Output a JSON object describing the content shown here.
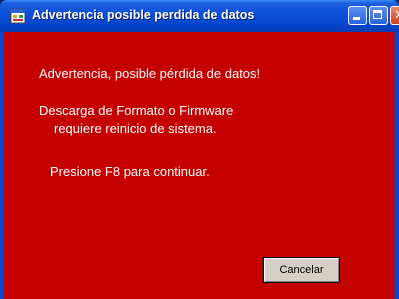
{
  "window": {
    "title": "Advertencia posible perdida de datos"
  },
  "message": {
    "line1": "Advertencia, posible pérdida de datos!",
    "line2": "Descarga de  Formato o Firmware",
    "line3": "requiere   reinicio de sistema.",
    "line4": "Presione F8 para continuar."
  },
  "buttons": {
    "cancel_label": "Cancelar"
  },
  "icons": {
    "app": "app-window-icon",
    "minimize": "minimize-icon",
    "maximize": "maximize-icon",
    "close": "close-icon"
  },
  "colors": {
    "background": "#c40000",
    "text": "#ffffff",
    "titlebar": "#0b4fd8"
  }
}
